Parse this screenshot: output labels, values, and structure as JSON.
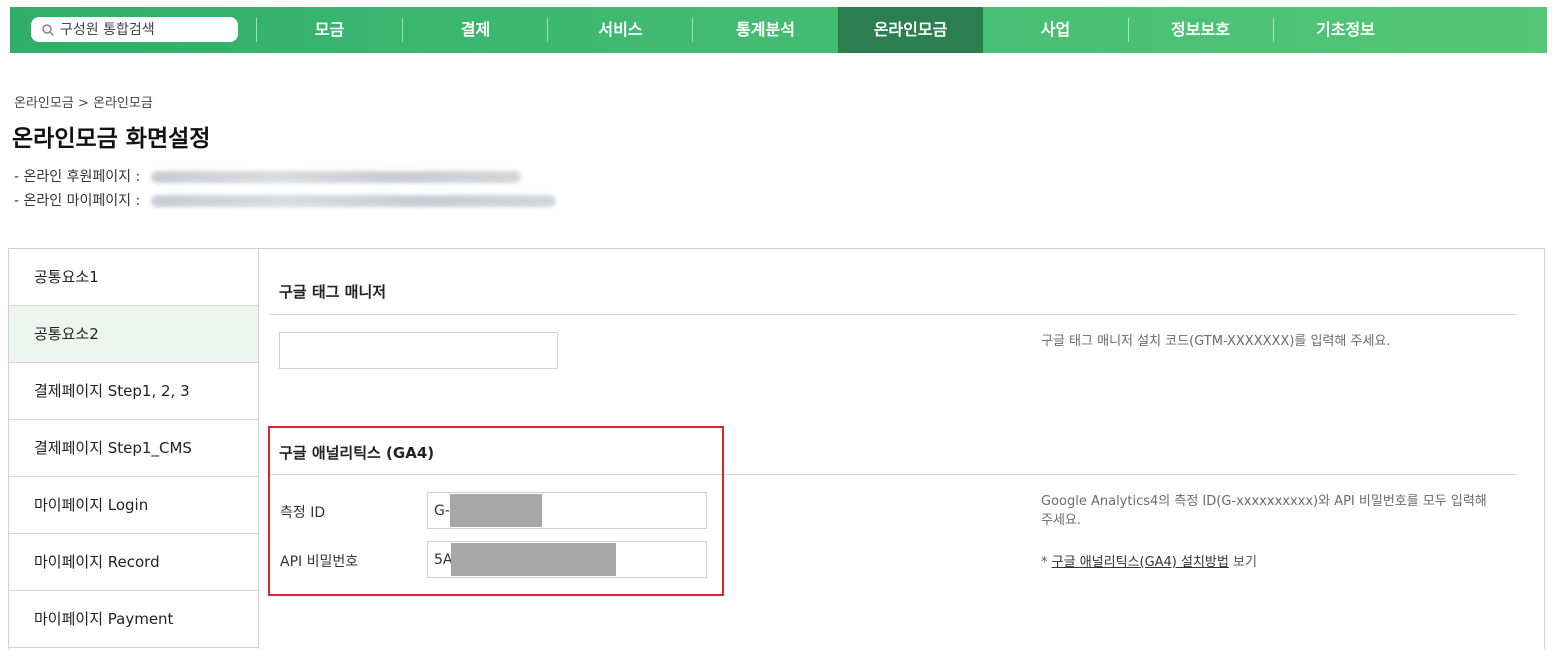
{
  "nav": {
    "search_placeholder": "구성원 통합검색",
    "items": [
      {
        "label": "모금"
      },
      {
        "label": "결제"
      },
      {
        "label": "서비스"
      },
      {
        "label": "통계분석"
      },
      {
        "label": "온라인모금"
      },
      {
        "label": "사업"
      },
      {
        "label": "정보보호"
      },
      {
        "label": "기초정보"
      }
    ],
    "active_index": 4
  },
  "breadcrumb": {
    "home": "온라인모금",
    "separator": ">",
    "current": "온라인모금"
  },
  "page_title": "온라인모금 화면설정",
  "urls": {
    "donation_label": "- 온라인 후원페이지 :",
    "mypage_label": "- 온라인 마이페이지 :"
  },
  "sidebar": {
    "items": [
      {
        "label": "공통요소1"
      },
      {
        "label": "공통요소2"
      },
      {
        "label": "결제페이지 Step1, 2, 3"
      },
      {
        "label": "결제페이지 Step1_CMS"
      },
      {
        "label": "마이페이지 Login"
      },
      {
        "label": "마이페이지 Record"
      },
      {
        "label": "마이페이지 Payment"
      }
    ],
    "active_index": 1
  },
  "gtm": {
    "title": "구글 태그 매니저",
    "value": "",
    "help": "구글 태그 매니저 설치 코드(GTM-XXXXXXX)를 입력해 주세요."
  },
  "ga4": {
    "title": "구글 애널리틱스 (GA4)",
    "measure_label": "측정 ID",
    "measure_value": "G-1            CX",
    "api_label": "API 비밀번호",
    "api_value": "5A                        YA",
    "help": "Google Analytics4의 측정 ID(G-xxxxxxxxxx)와 API 비밀번호를 모두 입력해 주세요.",
    "guide_prefix": "* ",
    "guide_link": "구글 애널리틱스(GA4) 설치방법",
    "guide_suffix": " 보기"
  },
  "colors": {
    "nav_green": "#43bc72",
    "nav_active": "#2a7e4f",
    "highlight_red": "#d9252c",
    "sidebar_active": "#eef5f0"
  }
}
